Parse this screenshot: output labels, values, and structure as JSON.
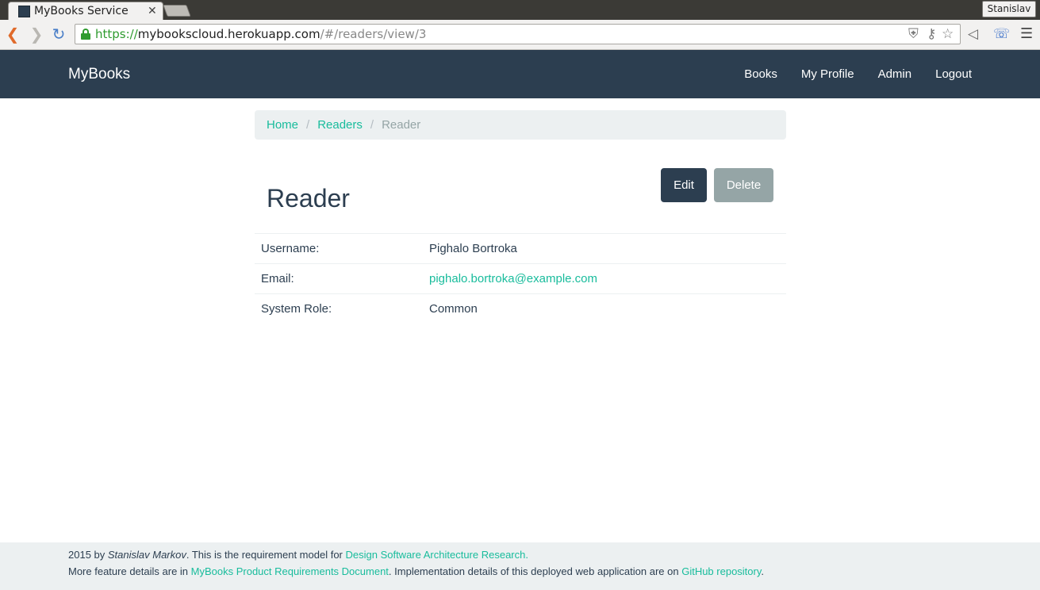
{
  "browser": {
    "tab_title": "MyBooks Service",
    "tab_close": "✕",
    "profile_name": "Stanislav",
    "url_scheme": "https://",
    "url_host": "mybookscloud.herokuapp.com",
    "url_path": "/#/readers/view/3",
    "icons": {
      "back": "back-arrow-icon",
      "forward": "forward-arrow-icon",
      "reload": "reload-icon",
      "lock": "lock-icon",
      "shield": "shield-icon",
      "key": "key-icon",
      "star": "bookmark-star-icon",
      "ext1": "megaphone-icon",
      "ext2": "phone-icon",
      "menu": "hamburger-menu-icon"
    }
  },
  "navbar": {
    "brand": "MyBooks",
    "links": [
      "Books",
      "My Profile",
      "Admin",
      "Logout"
    ]
  },
  "breadcrumb": {
    "items": [
      "Home",
      "Readers"
    ],
    "active": "Reader",
    "separator": "/"
  },
  "page": {
    "title": "Reader",
    "edit_label": "Edit",
    "delete_label": "Delete"
  },
  "details": [
    {
      "label": "Username:",
      "value": "Pighalo Bortroka"
    },
    {
      "label": "Email:",
      "value": "pighalo.bortroka@example.com"
    },
    {
      "label": "System Role:",
      "value": "Common"
    }
  ],
  "footer": {
    "line1_prefix": "2015 by ",
    "author": "Stanislav Markov",
    "line1_middle": ". This is the requirement model for ",
    "line1_link": "Design Software Architecture Research.",
    "line2_prefix": "More feature details are in ",
    "line2_link1": "MyBooks Product Requirements Document",
    "line2_middle": ". Implementation details of this deployed web application are on ",
    "line2_link2": "GitHub repository",
    "line2_suffix": "."
  },
  "colors": {
    "navbar_bg": "#2c3e50",
    "accent": "#18bc9c",
    "muted": "#95a5a6",
    "light_bg": "#ecf0f1"
  }
}
